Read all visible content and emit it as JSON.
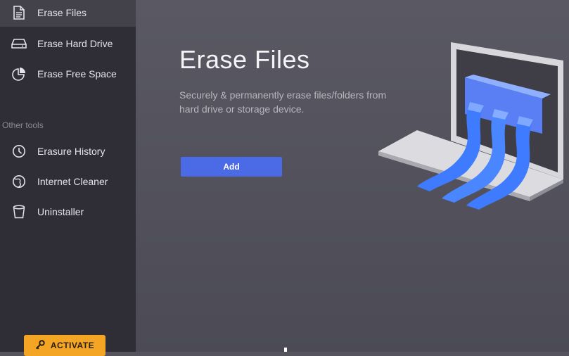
{
  "sidebar": {
    "items": [
      {
        "label": "Erase Files",
        "icon": "document-icon",
        "active": true
      },
      {
        "label": "Erase Hard Drive",
        "icon": "hard-drive-icon",
        "active": false
      },
      {
        "label": "Erase Free Space",
        "icon": "pie-chart-icon",
        "active": false
      }
    ],
    "section_label": "Other tools",
    "tools": [
      {
        "label": "Erasure History",
        "icon": "clock-icon"
      },
      {
        "label": "Internet Cleaner",
        "icon": "globe-icon"
      },
      {
        "label": "Uninstaller",
        "icon": "trash-icon"
      }
    ],
    "activate_label": "ACTIVATE",
    "activate_icon": "key-icon"
  },
  "main": {
    "title": "Erase Files",
    "subtitle": "Securely & permanently erase files/folders from hard drive or storage device.",
    "add_label": "Add",
    "illustration": "laptop-shredder-illustration"
  },
  "colors": {
    "sidebar_bg": "#2f2e37",
    "active_item_bg": "#43424b",
    "main_bg": "#55545e",
    "accent_blue": "#4a6ae6",
    "activate_orange": "#f5a524"
  }
}
